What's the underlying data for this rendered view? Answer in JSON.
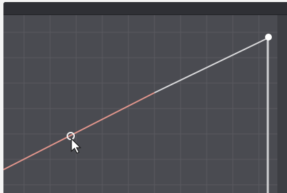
{
  "panel": {
    "name": "curves-editor",
    "colors": {
      "background": "#4a4b51",
      "grid_line": "#5a5b61",
      "curve_lower": "#e0958c",
      "curve_upper": "#d8d8da",
      "handle_fill": "#ffffff",
      "control_point_stroke": "#f2f2f2",
      "cursor": "#ffffff"
    },
    "curve": {
      "start_level": 0.0,
      "end_level": 1.0,
      "selected_point_level": 0.37
    },
    "icons": {
      "cursor": "arrow-cursor-icon",
      "control_point": "circle-control-point",
      "end_handle": "end-point-handle"
    }
  }
}
